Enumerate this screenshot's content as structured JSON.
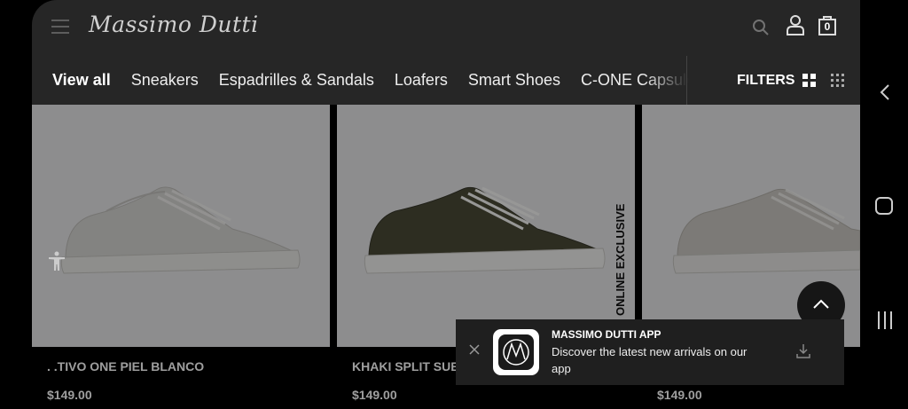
{
  "header": {
    "logo_text": "Massimo Dutti",
    "bag_count": "0"
  },
  "categories": {
    "tabs": [
      {
        "label": "View all",
        "active": true
      },
      {
        "label": "Sneakers",
        "active": false
      },
      {
        "label": "Espadrilles & Sandals",
        "active": false
      },
      {
        "label": "Loafers",
        "active": false
      },
      {
        "label": "Smart Shoes",
        "active": false
      },
      {
        "label": "C-ONE Capsule",
        "active": false
      }
    ],
    "filters_label": "FILTERS"
  },
  "products": [
    {
      "name": ". .TIVO ONE PIEL BLANCO",
      "price": "$149.00",
      "shoe_color": "#d4d3d0"
    },
    {
      "name": "KHAKI SPLIT SUEDE",
      "price": "$149.00",
      "shoe_color": "#4a4a36",
      "badge": "ONLINE EXCLUSIVE"
    },
    {
      "name": "",
      "price": "$149.00",
      "shoe_color": "#c9c6c0"
    }
  ],
  "app_banner": {
    "title": "MASSIMO DUTTI APP",
    "description": "Discover the latest new arrivals on our app"
  },
  "colors": {
    "bar_bg": "#262626",
    "image_bg": "#e4e4e6",
    "banner_bg": "#1f1f1f"
  }
}
